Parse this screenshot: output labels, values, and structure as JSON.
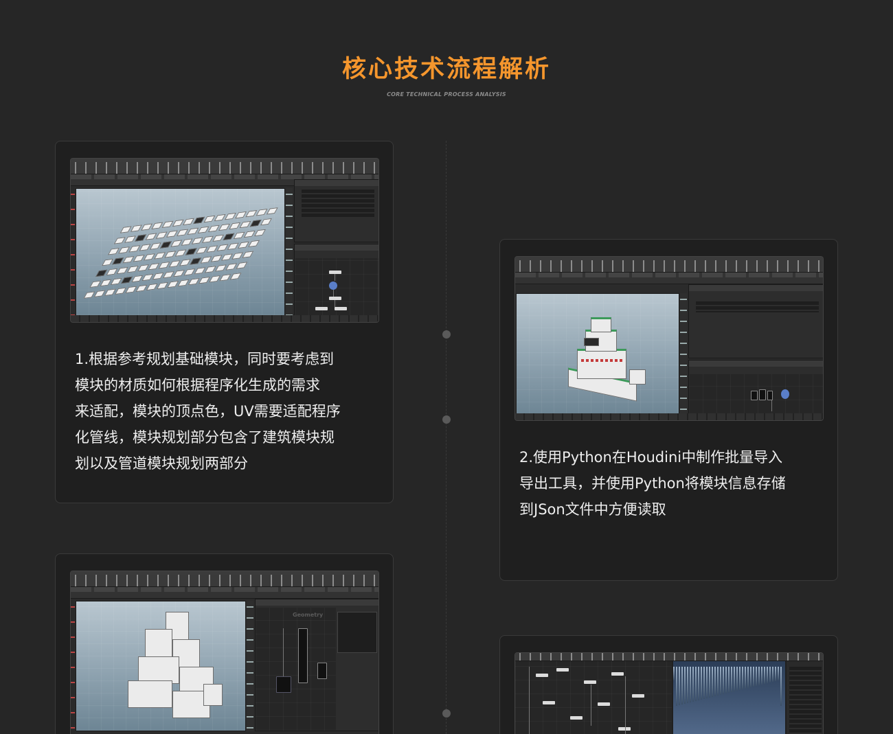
{
  "header": {
    "title": "核心技术流程解析",
    "subtitle": "CORE TECHNICAL PROCESS ANALYSIS"
  },
  "colors": {
    "accent": "#f5962d",
    "background": "#262626",
    "card": "#1f1f1f",
    "text": "#eeeeee"
  },
  "cards": [
    {
      "lines": [
        "1.根据参考规划基础模块，同时要考虑到",
        "模块的材质如何根据程序化生成的需求",
        "来适配，模块的顶点色，UV需要适配程序",
        "化管线，模块规划部分包含了建筑模块规",
        "划以及管道模块规划两部分"
      ],
      "image": "houdini-module-planning-screenshot"
    },
    {
      "lines": [
        "2.使用Python在Houdini中制作批量导入",
        "导出工具，并使用Python将模块信息存储",
        "到JSon文件中方便读取"
      ],
      "image": "houdini-building-export-screenshot"
    },
    {
      "image": "houdini-tower-generation-screenshot",
      "panel_label": "Geometry"
    },
    {
      "image": "houdini-node-graph-screenshot"
    }
  ]
}
